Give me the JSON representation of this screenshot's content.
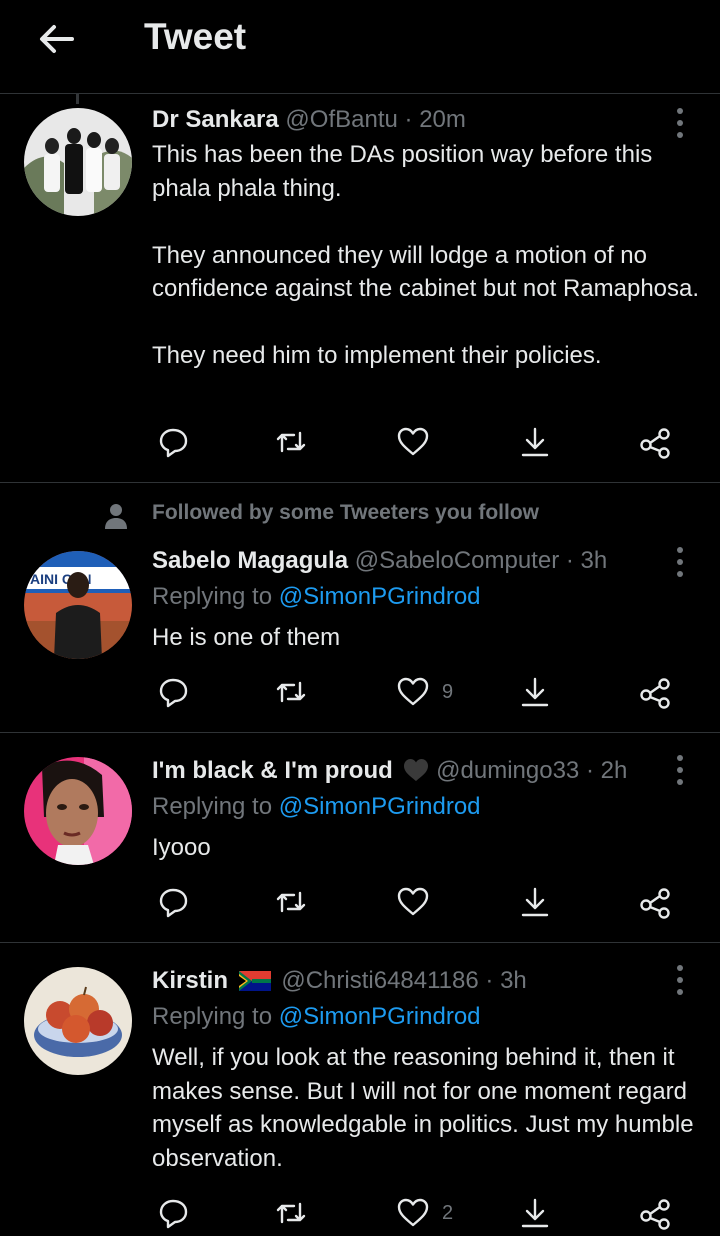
{
  "header": {
    "title": "Tweet"
  },
  "tweets": [
    {
      "name": "Dr Sankara",
      "handle": "@OfBantu",
      "separator": "·",
      "time": "20m",
      "text": "This has been the DAs position way before this phala phala thing.\n\nThey announced they will  lodge a motion of no confidence against the cabinet but not Ramaphosa.\n\nThey need him to implement their policies.",
      "likes": ""
    },
    {
      "social_context": "Followed by some Tweeters you follow",
      "name": "Sabelo Magagula",
      "handle": "@SabeloComputer",
      "separator": "·",
      "time": "3h",
      "replying_prefix": "Replying to",
      "replying_to": "@SimonPGrindrod",
      "avatar_text": "AINI  CEN",
      "text": "He is one of them",
      "likes": "9"
    },
    {
      "name": "I'm black & I'm proud",
      "name_emoji": "black-heart-emoji",
      "handle": "@dumingo33",
      "separator": "·",
      "time": "2h",
      "replying_prefix": "Replying to",
      "replying_to": "@SimonPGrindrod",
      "text": "Iyooo",
      "likes": ""
    },
    {
      "name": "Kirstin",
      "name_emoji": "south-africa-flag-emoji",
      "handle": "@Christi64841186",
      "separator": "·",
      "time": "3h",
      "replying_prefix": "Replying to",
      "replying_to": "@SimonPGrindrod",
      "text": "Well, if you look at the reasoning behind it, then it makes sense. But I will not for one moment regard myself as knowledgable in politics. Just my humble observation.",
      "likes": "2"
    }
  ],
  "icons": {
    "back": "arrow-left-icon",
    "more": "more-vertical-icon",
    "reply": "reply-icon",
    "retweet": "retweet-icon",
    "like": "heart-icon",
    "bookmark": "download-icon",
    "share": "share-icon",
    "followed": "person-icon"
  },
  "colors": {
    "background": "#000000",
    "text": "#e7e9ea",
    "secondary": "#71767b",
    "link": "#1d9bf0",
    "divider": "#2f3336"
  }
}
